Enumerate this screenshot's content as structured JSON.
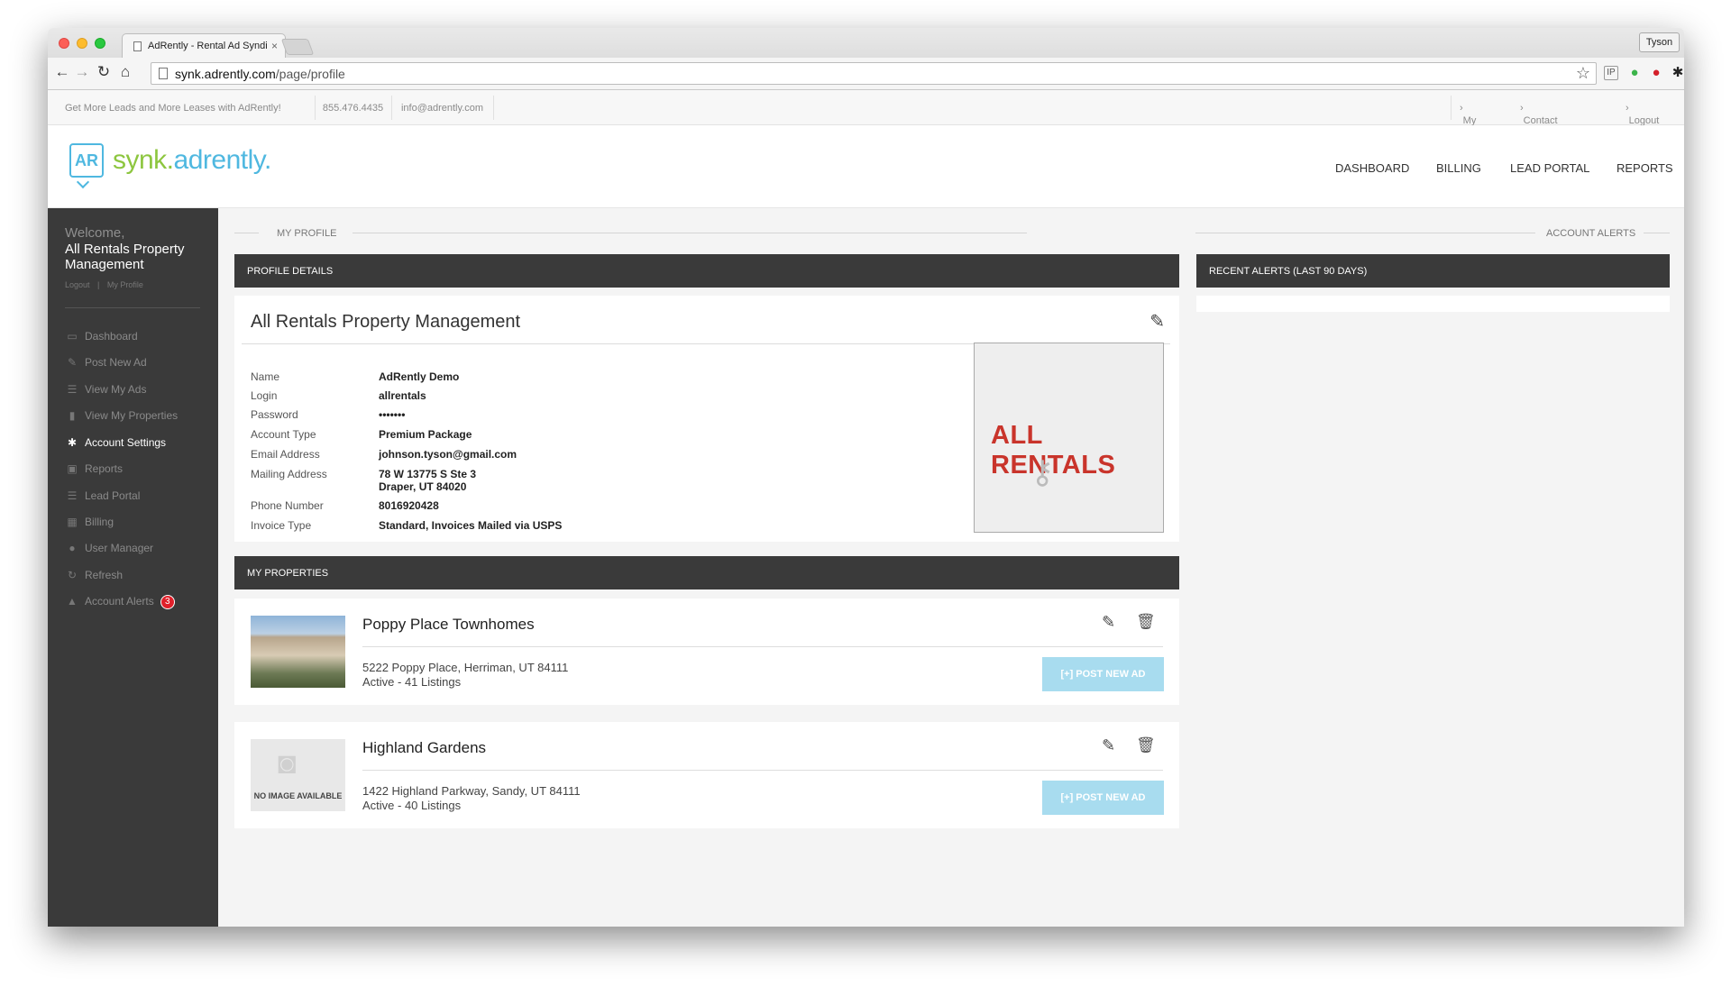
{
  "browser": {
    "tab_title": "AdRently - Rental Ad Syndi",
    "tab_close": "×",
    "user_button": "Tyson",
    "url_host": "synk.adrently.com",
    "url_path": "/page/profile"
  },
  "topbar": {
    "tagline": "Get More Leads and More Leases with AdRently!",
    "phone": "855.476.4435",
    "email": "info@adrently.com",
    "links": [
      "My Profile",
      "Contact AdRently",
      "Logout"
    ]
  },
  "header": {
    "logo_mark": "AR",
    "logo_part1": "synk.",
    "logo_part2": "adrently.",
    "nav": [
      "DASHBOARD",
      "BILLING",
      "LEAD PORTAL",
      "REPORTS"
    ]
  },
  "sidebar": {
    "welcome": "Welcome,",
    "company": "All Rentals Property Management",
    "logout": "Logout",
    "divider": "|",
    "my_profile": "My Profile",
    "items": [
      {
        "label": "Dashboard",
        "icon": "dashboard-icon"
      },
      {
        "label": "Post New Ad",
        "icon": "pencil-icon"
      },
      {
        "label": "View My Ads",
        "icon": "list-icon"
      },
      {
        "label": "View My Properties",
        "icon": "bar-chart-icon"
      },
      {
        "label": "Account Settings",
        "icon": "gear-icon"
      },
      {
        "label": "Reports",
        "icon": "reports-icon"
      },
      {
        "label": "Lead Portal",
        "icon": "list-icon"
      },
      {
        "label": "Billing",
        "icon": "calendar-icon"
      },
      {
        "label": "User Manager",
        "icon": "users-icon"
      },
      {
        "label": "Refresh",
        "icon": "refresh-icon"
      },
      {
        "label": "Account Alerts",
        "icon": "warning-icon",
        "badge": "3"
      }
    ]
  },
  "profile": {
    "section_label": "MY PROFILE",
    "bar_title": "PROFILE DETAILS",
    "company_name": "All Rentals Property Management",
    "logo_text": "ALL RENTALS",
    "fields": [
      {
        "label": "Name",
        "value": "AdRently Demo"
      },
      {
        "label": "Login",
        "value": "allrentals"
      },
      {
        "label": "Password",
        "value": "•••••••"
      },
      {
        "label": "Account Type",
        "value": "Premium Package"
      },
      {
        "label": "Email Address",
        "value": "johnson.tyson@gmail.com"
      },
      {
        "label": "Mailing Address",
        "value": "78 W 13775 S Ste 3",
        "value2": "Draper, UT 84020"
      },
      {
        "label": "Phone Number",
        "value": "8016920428"
      },
      {
        "label": "Invoice Type",
        "value": "Standard, Invoices Mailed via USPS"
      }
    ]
  },
  "properties": {
    "bar_title": "MY PROPERTIES",
    "post_label": "[+] POST NEW AD",
    "no_image": "NO IMAGE AVAILABLE",
    "items": [
      {
        "name": "Poppy Place Townhomes",
        "address": "5222 Poppy Place, Herriman, UT 84111",
        "status": "Active - 41 Listings"
      },
      {
        "name": "Highland Gardens",
        "address": "1422 Highland Parkway, Sandy, UT 84111",
        "status": "Active - 40 Listings"
      }
    ]
  },
  "alerts": {
    "section_label": "ACCOUNT ALERTS",
    "bar_title": "RECENT ALERTS (LAST 90 DAYS)"
  }
}
